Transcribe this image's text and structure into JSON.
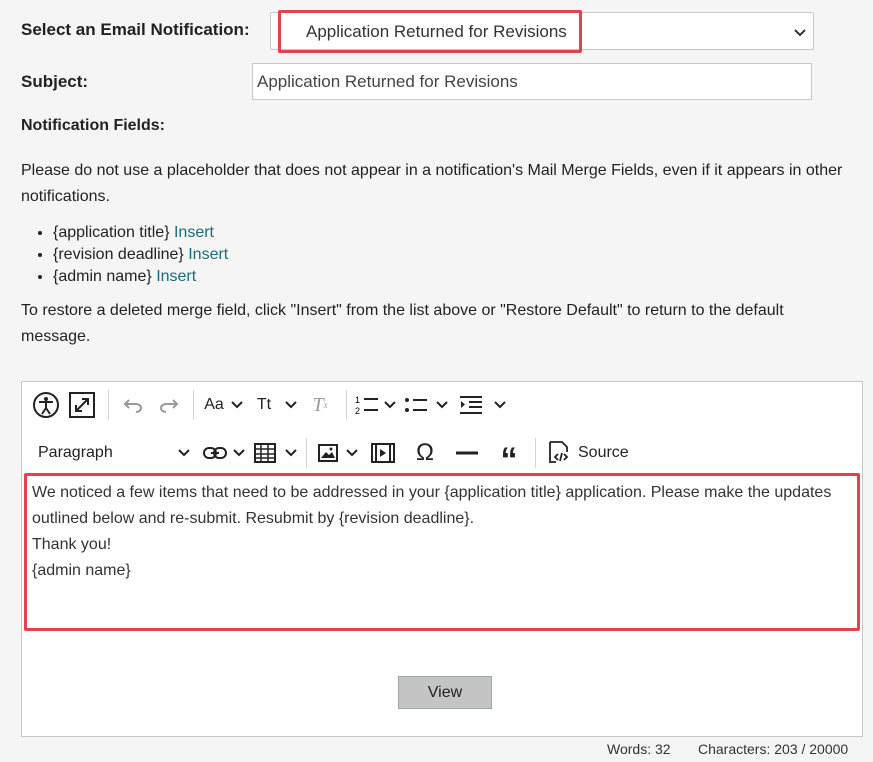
{
  "notification": {
    "label": "Select an Email Notification:",
    "selected": "Application Returned for Revisions"
  },
  "subject": {
    "label": "Subject:",
    "value": "Application Returned for Revisions"
  },
  "fields_heading": "Notification Fields:",
  "warning": "Please do not use a placeholder that does not appear in a notification's Mail Merge Fields, even if it appears in other notifications.",
  "merge_fields": [
    {
      "name": "{application title}",
      "action": "Insert"
    },
    {
      "name": "{revision deadline}",
      "action": "Insert"
    },
    {
      "name": "{admin name}",
      "action": "Insert"
    }
  ],
  "restore_note": "To restore a deleted merge field, click \"Insert\" from the list above or \"Restore Default\" to return to the default message.",
  "toolbar": {
    "paragraph": "Paragraph",
    "source": "Source",
    "icons": [
      "accessibility-icon",
      "fullscreen-icon",
      "undo-icon",
      "redo-icon",
      "font-size-icon",
      "text-case-icon",
      "remove-format-icon",
      "numbered-list-icon",
      "bulleted-list-icon",
      "indent-icon",
      "link-icon",
      "table-icon",
      "image-icon",
      "media-icon",
      "special-characters-icon",
      "horizontal-line-icon",
      "blockquote-icon",
      "source-icon"
    ]
  },
  "editor": {
    "line1": "We noticed a few items that need to be addressed in your {application title} application. Please make the updates outlined below and re-submit. Resubmit by {revision deadline}.",
    "line2": "Thank you!",
    "line3": "{admin name}",
    "button": "View"
  },
  "status": {
    "words": "Words: 32",
    "characters": "Characters: 203 / 20000"
  },
  "colors": {
    "highlight": "#e0434b",
    "link": "#1a6b78"
  }
}
